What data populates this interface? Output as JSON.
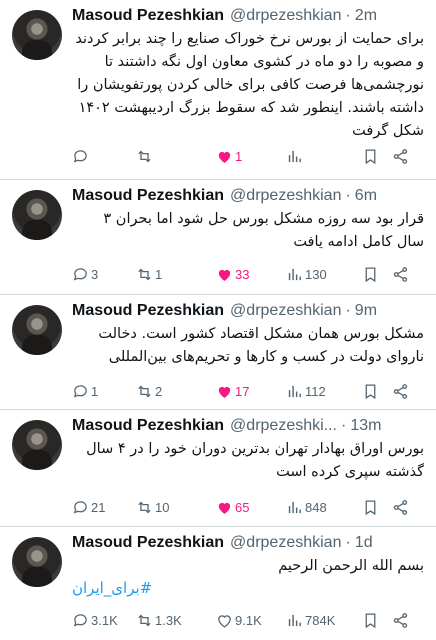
{
  "author": {
    "name": "Masoud Pezeshkian",
    "handle": "@drpezeshkian",
    "handle_truncated": "@drpezeshki..."
  },
  "separator": "·",
  "colors": {
    "text": "#0f1419",
    "muted": "#536471",
    "like": "#f91880",
    "link": "#1d9bf0",
    "border": "#cfd9de"
  },
  "tweets": [
    {
      "time": "2m",
      "text": "برای حمایت از بورس نرخ خوراک صنایع را چند برابر کردند و مصوبه را دو ماه در کشوی معاون اول نگه داشتند تا نورچشمی‌ها فرصت کافی برای خالی کردن پورتفویشان را داشته باشند. اینطور شد که سقوط بزرگ اردیبهشت ۱۴۰۲ شکل گرفت",
      "replies": "",
      "retweets": "",
      "likes": "1",
      "views": ""
    },
    {
      "time": "6m",
      "text": "قرار بود سه روزه مشکل بورس حل شود اما بحران ۳ سال کامل ادامه یافت",
      "replies": "3",
      "retweets": "1",
      "likes": "33",
      "views": "130"
    },
    {
      "time": "9m",
      "text": "مشکل بورس همان مشکل اقتصاد کشور است. دخالت ناروای دولت در کسب و کارها و تحریم‌های بین‌المللی",
      "replies": "1",
      "retweets": "2",
      "likes": "17",
      "views": "112"
    },
    {
      "time": "13m",
      "text": "بورس اوراق بهادار تهران بدترین دوران خود را در ۴ سال گذشته سپری کرده است",
      "replies": "21",
      "retweets": "10",
      "likes": "65",
      "views": "848"
    },
    {
      "time": "1d",
      "text": "بسم الله الرحمن الرحیم",
      "hashtag": "#برای_ایران",
      "replies": "3.1K",
      "retweets": "1.3K",
      "likes": "9.1K",
      "views": "784K"
    }
  ]
}
